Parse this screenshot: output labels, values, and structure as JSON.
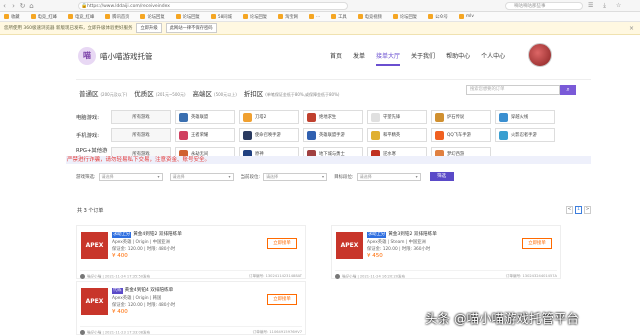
{
  "browser": {
    "url": "https://www.lddaiji.com/receiveindex",
    "search_placeholder": "嘀咕嘀咕那些事",
    "bookmarks": [
      "收藏",
      "电竞_红峰",
      "电竞_红峰",
      "腾讯首页",
      "论坛回复",
      "论坛回复",
      "58同城",
      "论坛回复",
      "淘宝网",
      "...",
      "工具",
      "电竞视频",
      "论坛回复",
      "公众号",
      "mlv"
    ]
  },
  "notice": {
    "text": "您所使用 360极速浏览器 新版现已发布，立即升级体验更好服务",
    "btn_primary": "立即升级",
    "btn_secondary": "此网站一律不保存密码"
  },
  "site": {
    "logo_char": "喵",
    "title": "喵小喵游戏托管"
  },
  "nav": {
    "items": [
      {
        "label": "首页",
        "active": false
      },
      {
        "label": "发单",
        "active": false
      },
      {
        "label": "接单大厅",
        "active": true
      },
      {
        "label": "关于我们",
        "active": false
      },
      {
        "label": "帮助中心",
        "active": false
      },
      {
        "label": "个人中心",
        "active": false
      }
    ]
  },
  "zones": [
    {
      "name": "普通区",
      "desc": "(200元及以下)"
    },
    {
      "name": "优质区",
      "desc": "(201元~500元)"
    },
    {
      "name": "高端区",
      "desc": "(500元以上)"
    },
    {
      "name": "折扣区",
      "desc": "(单笔保证金低于80%,或保障金低于80%)"
    }
  ],
  "search": {
    "placeholder": "搜索您想要的订单",
    "button_icon": "search-icon"
  },
  "categories": {
    "pc": {
      "label": "电脑游戏:",
      "items": [
        {
          "label": "所有游戏",
          "color": ""
        },
        {
          "label": "英雄联盟",
          "color": "#3a6fb0"
        },
        {
          "label": "刀塔2",
          "color": "#f0a030"
        },
        {
          "label": "绝地求生",
          "color": "#c0402e"
        },
        {
          "label": "守望先锋",
          "color": "#e0e0e0"
        },
        {
          "label": "炉石传说",
          "color": "#d09030"
        },
        {
          "label": "穿越火线",
          "color": "#3a8fd0"
        }
      ]
    },
    "mobile": {
      "label": "手机游戏:",
      "items": [
        {
          "label": "所有游戏",
          "color": ""
        },
        {
          "label": "王者荣耀",
          "color": "#d04060"
        },
        {
          "label": "使命召唤手游",
          "color": "#2a3a60"
        },
        {
          "label": "英雄联盟手游",
          "color": "#3060b0"
        },
        {
          "label": "和平精英",
          "color": "#e0b030"
        },
        {
          "label": "QQ飞车手游",
          "color": "#f06020"
        },
        {
          "label": "火影忍者手游",
          "color": "#3a9fd0"
        }
      ]
    },
    "rpg": {
      "label": "RPG+其他游戏:",
      "items": [
        {
          "label": "所有游戏",
          "color": ""
        },
        {
          "label": "永劫无间",
          "color": "#d06030"
        },
        {
          "label": "原神",
          "color": "#204080"
        },
        {
          "label": "地下城与勇士",
          "color": "#a04040"
        },
        {
          "label": "逆水寒",
          "color": "#c03020"
        },
        {
          "label": "梦幻西游",
          "color": "#e08040"
        }
      ]
    }
  },
  "alert": "严禁进行诈骗，请勿轻易私下交易，注意资金、账号安全。",
  "filters": [
    {
      "label": "游戏筛选:",
      "value": "请选择"
    },
    {
      "label": "",
      "value": "请选择"
    },
    {
      "label": "当前段位:",
      "value": "请选择"
    },
    {
      "label": "目标段位:",
      "value": "请选择"
    }
  ],
  "filter_button": "筛选",
  "orders": {
    "count_text": "共 3 个订单",
    "pager": {
      "prev": "<",
      "current": "1",
      "next": ">"
    },
    "items": [
      {
        "badge": "求助上分",
        "title": "黄金4到铂2 双排陪练单",
        "logo": "APEX",
        "game": "Apex英雄 | Origin | 中国亚洲",
        "guarantee": "保证金: 120.00 | 时限: 480小时",
        "price": "¥ 400",
        "button": "立即接单",
        "user": "喵仔小喵",
        "time": "2021-11-24 17:35:50发布",
        "order_no": "订单编号: 13024114231488AT"
      },
      {
        "badge": "求助上分",
        "title": "黄金3到铂2 双排陪练单",
        "logo": "APEX",
        "game": "Apex英雄 | Steam | 中国亚洲",
        "guarantee": "保证金: 120.00 | 时限: 360小时",
        "price": "¥ 450",
        "button": "立即接单",
        "user": "喵仔小喵",
        "time": "2021-11-24 16:20:20发布",
        "order_no": "订单编号: 13024324401457A"
      },
      {
        "badge": "代练",
        "title": "黄金4到铂4 双排陪练单",
        "logo": "APEX",
        "game": "Apex英雄 | Origin | 韩国",
        "guarantee": "保证金: 120.00 | 时限: 480小时",
        "price": "¥ 400",
        "button": "立即接单",
        "user": "喵仔小喵",
        "time": "2021-11-23 17:33:08发布",
        "order_no": "订单编号: 11064915976HV7"
      }
    ]
  },
  "watermark": "头条 @喵小喵游戏托管平台"
}
